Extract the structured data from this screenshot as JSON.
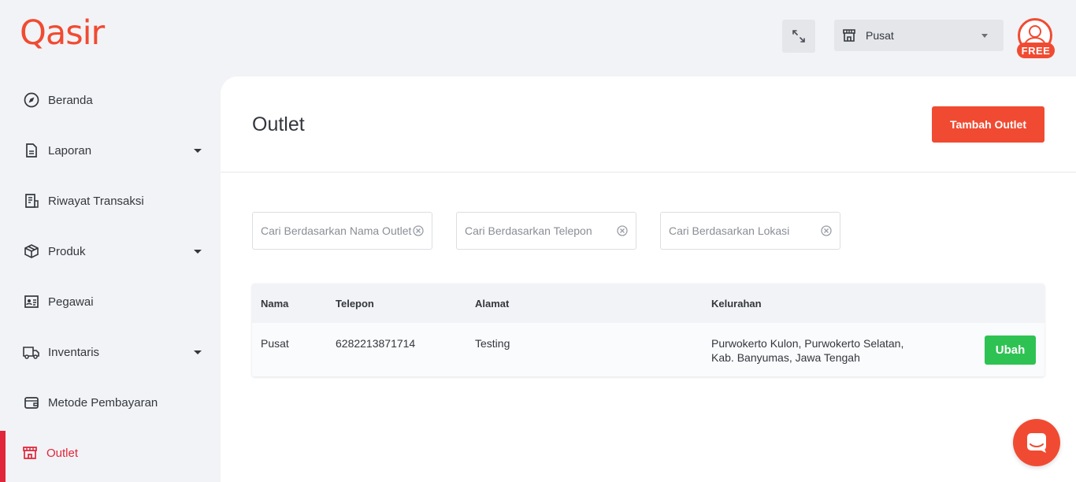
{
  "brand": {
    "logo_text": "Qasir",
    "accent": "#f04b32"
  },
  "header": {
    "outlet_selected": "Pusat",
    "plan_badge": "FREE"
  },
  "sidebar": {
    "items": [
      {
        "label": "Beranda",
        "icon": "compass-icon"
      },
      {
        "label": "Laporan",
        "icon": "document-icon",
        "dropdown": true
      },
      {
        "label": "Riwayat Transaksi",
        "icon": "receipt-icon"
      },
      {
        "label": "Produk",
        "icon": "box-icon",
        "dropdown": true
      },
      {
        "label": "Pegawai",
        "icon": "id-card-icon"
      },
      {
        "label": "Inventaris",
        "icon": "truck-icon",
        "dropdown": true
      },
      {
        "label": "Metode Pembayaran",
        "icon": "wallet-icon"
      },
      {
        "label": "Outlet",
        "icon": "store-icon",
        "active": true
      }
    ],
    "active_color": "#e1253b"
  },
  "page": {
    "title": "Outlet",
    "add_button": "Tambah Outlet",
    "search": {
      "name_placeholder": "Cari Berdasarkan Nama Outlet",
      "phone_placeholder": "Cari Berdasarkan Telepon",
      "location_placeholder": "Cari Berdasarkan Lokasi"
    },
    "table": {
      "columns": [
        "Nama",
        "Telepon",
        "Alamat",
        "Kelurahan"
      ],
      "rows": [
        {
          "nama": "Pusat",
          "telepon": "6282213871714",
          "alamat": "Testing",
          "kelurahan_line1": "Purwokerto Kulon, Purwokerto Selatan,",
          "kelurahan_line2": "Kab. Banyumas, Jawa Tengah",
          "edit_label": "Ubah"
        }
      ]
    }
  }
}
